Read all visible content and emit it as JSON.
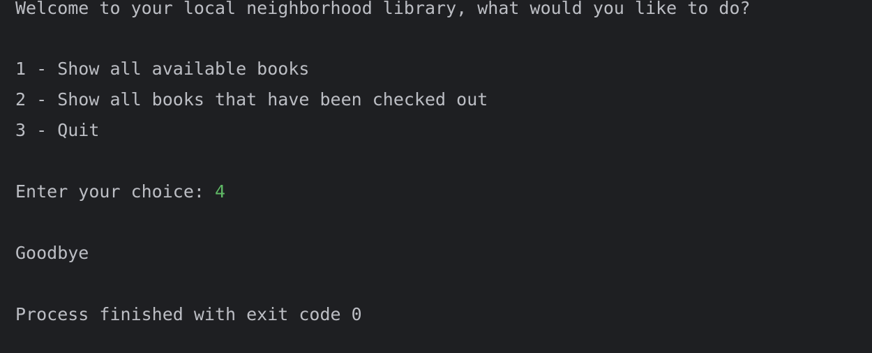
{
  "console": {
    "welcome": "Welcome to your local neighborhood library, what would you like to do?",
    "menu": [
      "1 - Show all available books",
      "2 - Show all books that have been checked out",
      "3 - Quit"
    ],
    "prompt": "Enter your choice: ",
    "user_input": "4",
    "goodbye": "Goodbye",
    "exit_message": "Process finished with exit code 0"
  },
  "colors": {
    "background": "#1e1f22",
    "text": "#bcbec4",
    "user_input": "#5fb865"
  }
}
